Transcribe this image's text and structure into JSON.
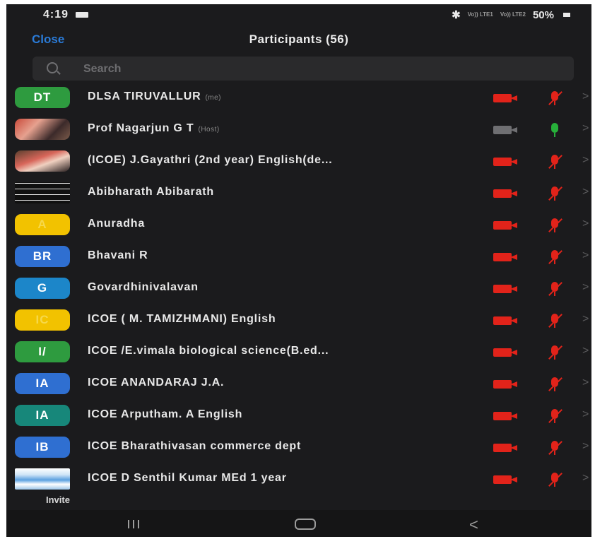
{
  "status_bar": {
    "time": "4:19",
    "battery": "50%",
    "network_left": "Vo)) LTE1",
    "network_right": "Vo)) LTE2"
  },
  "header": {
    "close_label": "Close",
    "title": "Participants (56)"
  },
  "search": {
    "placeholder": "Search"
  },
  "colors": {
    "accent": "#2a7bd8",
    "muted_red": "#e2231a",
    "unmuted_green": "#27b03a",
    "background": "#1b1b1d"
  },
  "participants": [
    {
      "initials": "DT",
      "avatar_color": "#2e9b3f",
      "name": "DLSA TIRUVALLUR",
      "role": "(me)",
      "video": "off",
      "audio": "muted"
    },
    {
      "initials": "",
      "avatar_color": "",
      "name": "Prof Nagarjun G T",
      "role": "(Host)",
      "video": "off-gray",
      "audio": "on"
    },
    {
      "initials": "",
      "avatar_color": "",
      "name": "(ICOE) J.Gayathri (2nd year) English(de...",
      "role": "",
      "video": "off",
      "audio": "muted"
    },
    {
      "initials": "",
      "avatar_color": "",
      "name": "Abibharath Abibarath",
      "role": "",
      "video": "off",
      "audio": "muted"
    },
    {
      "initials": "A",
      "avatar_color": "#f2c200",
      "name": "Anuradha",
      "role": "",
      "video": "off",
      "audio": "muted"
    },
    {
      "initials": "BR",
      "avatar_color": "#2f6fd1",
      "name": "Bhavani R",
      "role": "",
      "video": "off",
      "audio": "muted"
    },
    {
      "initials": "G",
      "avatar_color": "#1c86c9",
      "name": "Govardhinivalavan",
      "role": "",
      "video": "off",
      "audio": "muted"
    },
    {
      "initials": "IC",
      "avatar_color": "#f2c200",
      "name": "ICOE ( M. TAMIZHMANI) English",
      "role": "",
      "video": "off",
      "audio": "muted"
    },
    {
      "initials": "I/",
      "avatar_color": "#2e9b3f",
      "name": "ICOE /E.vimala biological science(B.ed...",
      "role": "",
      "video": "off",
      "audio": "muted"
    },
    {
      "initials": "IA",
      "avatar_color": "#2f6fd1",
      "name": "ICOE ANANDARAJ  J.A.",
      "role": "",
      "video": "off",
      "audio": "muted"
    },
    {
      "initials": "IA",
      "avatar_color": "#17877a",
      "name": "ICOE Arputham. A English",
      "role": "",
      "video": "off",
      "audio": "muted"
    },
    {
      "initials": "IB",
      "avatar_color": "#2f6fd1",
      "name": "ICOE Bharathivasan commerce dept",
      "role": "",
      "video": "off",
      "audio": "muted"
    },
    {
      "initials": "",
      "avatar_color": "",
      "name": "ICOE D Senthil Kumar MEd 1 year",
      "role": "",
      "video": "off",
      "audio": "muted"
    }
  ],
  "footer": {
    "invite_label": "Invite"
  }
}
